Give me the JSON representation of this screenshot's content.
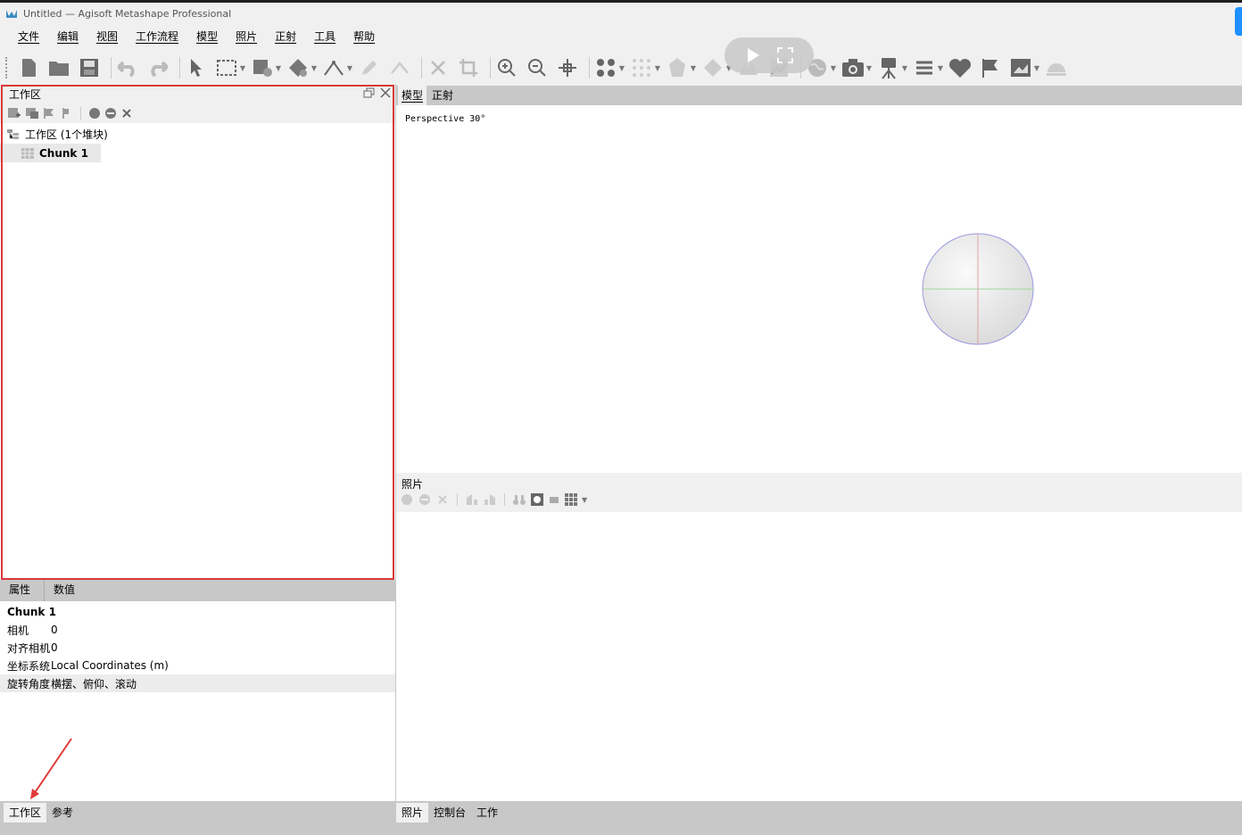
{
  "window": {
    "title": "Untitled — Agisoft Metashape Professional"
  },
  "menu": [
    "文件",
    "编辑",
    "视图",
    "工作流程",
    "模型",
    "照片",
    "正射",
    "工具",
    "帮助"
  ],
  "toolbar": {
    "icons": [
      "new-document-icon",
      "open-folder-icon",
      "save-icon",
      "undo-icon",
      "redo-icon",
      "select-pointer-icon",
      "rectangle-select-icon",
      "shape-draw-icon",
      "marker-tool-icon",
      "ruler-icon",
      "pencil-icon",
      "polyline-icon",
      "delete-icon",
      "crop-icon",
      "zoom-in-icon",
      "zoom-out-icon",
      "reset-view-icon",
      "points-icon",
      "dense-points-icon",
      "mesh-icon",
      "tiled-model-icon",
      "dem-icon",
      "orthomosaic-icon",
      "globe-icon",
      "camera-icon",
      "camera-tripod-icon",
      "list-icon",
      "heart-marker-icon",
      "flag-icon",
      "image-icon",
      "dome-icon"
    ]
  },
  "workspace": {
    "header": "工作区",
    "root_label": "工作区 (1个堆块)",
    "chunk_label": "Chunk 1"
  },
  "properties": {
    "tabs": [
      "属性",
      "数值"
    ],
    "chunk_name": "Chunk 1",
    "rows": [
      {
        "key": "相机",
        "value": "0"
      },
      {
        "key": "对齐相机",
        "value": "0"
      },
      {
        "key": "坐标系统",
        "value": "Local Coordinates (m)"
      },
      {
        "key": "旋转角度",
        "value": "横摆、俯仰、滚动"
      }
    ]
  },
  "left_bottom_tabs": [
    "工作区",
    "参考"
  ],
  "model_view": {
    "tabs": [
      "模型",
      "正射"
    ],
    "perspective_label": "Perspective 30°"
  },
  "photos_pane": {
    "title": "照片"
  },
  "right_bottom_tabs": [
    "照片",
    "控制台",
    "工作"
  ],
  "colors": {
    "highlight_box": "#d93838",
    "accent_blue": "#1e90ff",
    "panel_bg": "#f0f0f0",
    "tab_bar": "#c8c8c8"
  }
}
